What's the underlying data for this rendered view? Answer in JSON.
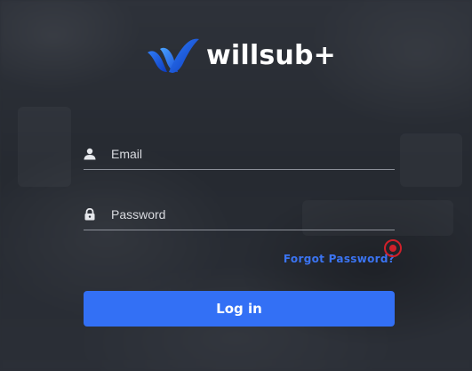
{
  "brand": {
    "name": "willsub+",
    "logo_icon": "willsub-w-logo-icon",
    "primary_color": "#3370f5",
    "logo_gradient": [
      "#1a4fd8",
      "#4aa3ff"
    ]
  },
  "login_form": {
    "email": {
      "placeholder": "Email",
      "value": "",
      "icon": "user-icon"
    },
    "password": {
      "placeholder": "Password",
      "value": "",
      "icon": "lock-icon"
    },
    "forgot_password_label": "Forgot Password?",
    "login_button_label": "Log in"
  }
}
